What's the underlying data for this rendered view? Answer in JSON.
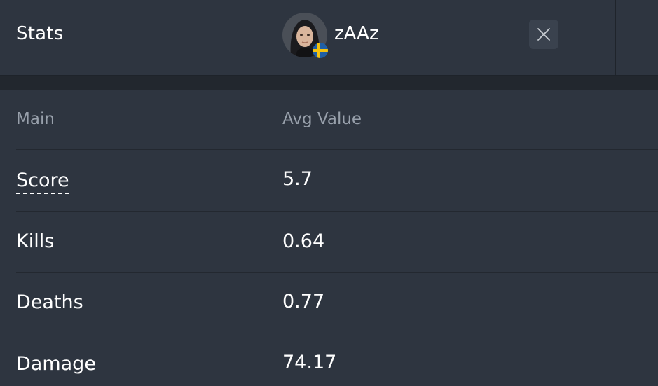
{
  "header": {
    "title": "Stats",
    "player_name": "zAAz",
    "flag": "sweden-flag",
    "close_icon": "close-icon"
  },
  "table": {
    "columns": [
      "Main",
      "Avg Value"
    ],
    "rows": [
      {
        "label": "Score",
        "value": "5.7"
      },
      {
        "label": "Kills",
        "value": "0.64"
      },
      {
        "label": "Deaths",
        "value": "0.77"
      },
      {
        "label": "Damage",
        "value": "74.17"
      }
    ]
  },
  "colors": {
    "background": "#2e3540",
    "band": "#22272e",
    "muted_text": "#98a0ab",
    "flag_blue": "#1f5fa6",
    "flag_yellow": "#f4c20d"
  }
}
